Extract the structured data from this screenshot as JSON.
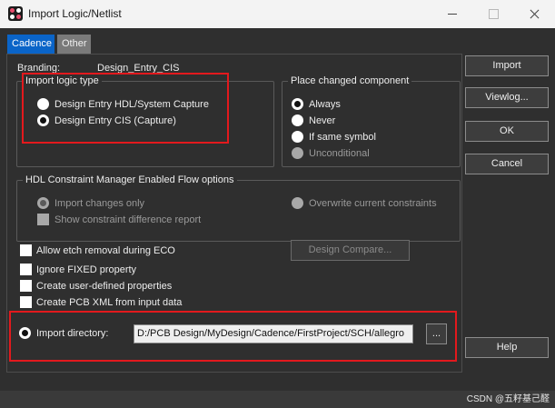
{
  "window": {
    "title": "Import Logic/Netlist"
  },
  "tabs": [
    {
      "label": "Cadence"
    },
    {
      "label": "Other"
    }
  ],
  "branding": {
    "label": "Branding:",
    "value": "Design_Entry_CIS"
  },
  "import_logic_type": {
    "title": "Import logic type",
    "options": [
      {
        "label": "Design Entry HDL/System Capture",
        "checked": false
      },
      {
        "label": "Design Entry CIS (Capture)",
        "checked": true
      }
    ]
  },
  "place_changed": {
    "title": "Place changed component",
    "options": [
      {
        "label": "Always",
        "checked": true
      },
      {
        "label": "Never",
        "checked": false
      },
      {
        "label": "If same symbol",
        "checked": false
      },
      {
        "label": "Unconditional",
        "checked": false,
        "disabled": true
      }
    ]
  },
  "hdl_constraint": {
    "title": "HDL Constraint Manager Enabled Flow options",
    "import_changes_only": "Import changes only",
    "overwrite": "Overwrite current constraints",
    "show_diff": "Show constraint difference report"
  },
  "options": {
    "allow_etch": "Allow etch removal during ECO",
    "ignore_fixed": "Ignore FIXED property",
    "create_user_props": "Create user-defined properties",
    "create_pcb_xml": "Create PCB XML from input data",
    "design_compare": "Design Compare..."
  },
  "import_directory": {
    "label": "Import directory:",
    "value": "D:/PCB Design/MyDesign/Cadence/FirstProject/SCH/allegro",
    "browse": "..."
  },
  "buttons": {
    "import": "Import",
    "viewlog": "Viewlog...",
    "ok": "OK",
    "cancel": "Cancel",
    "help": "Help"
  },
  "watermark": "CSDN @五籽基己醛",
  "colors": {
    "accent_tab": "#0a64c8",
    "highlight_box": "#e3191d",
    "background": "#2f2f2f"
  }
}
